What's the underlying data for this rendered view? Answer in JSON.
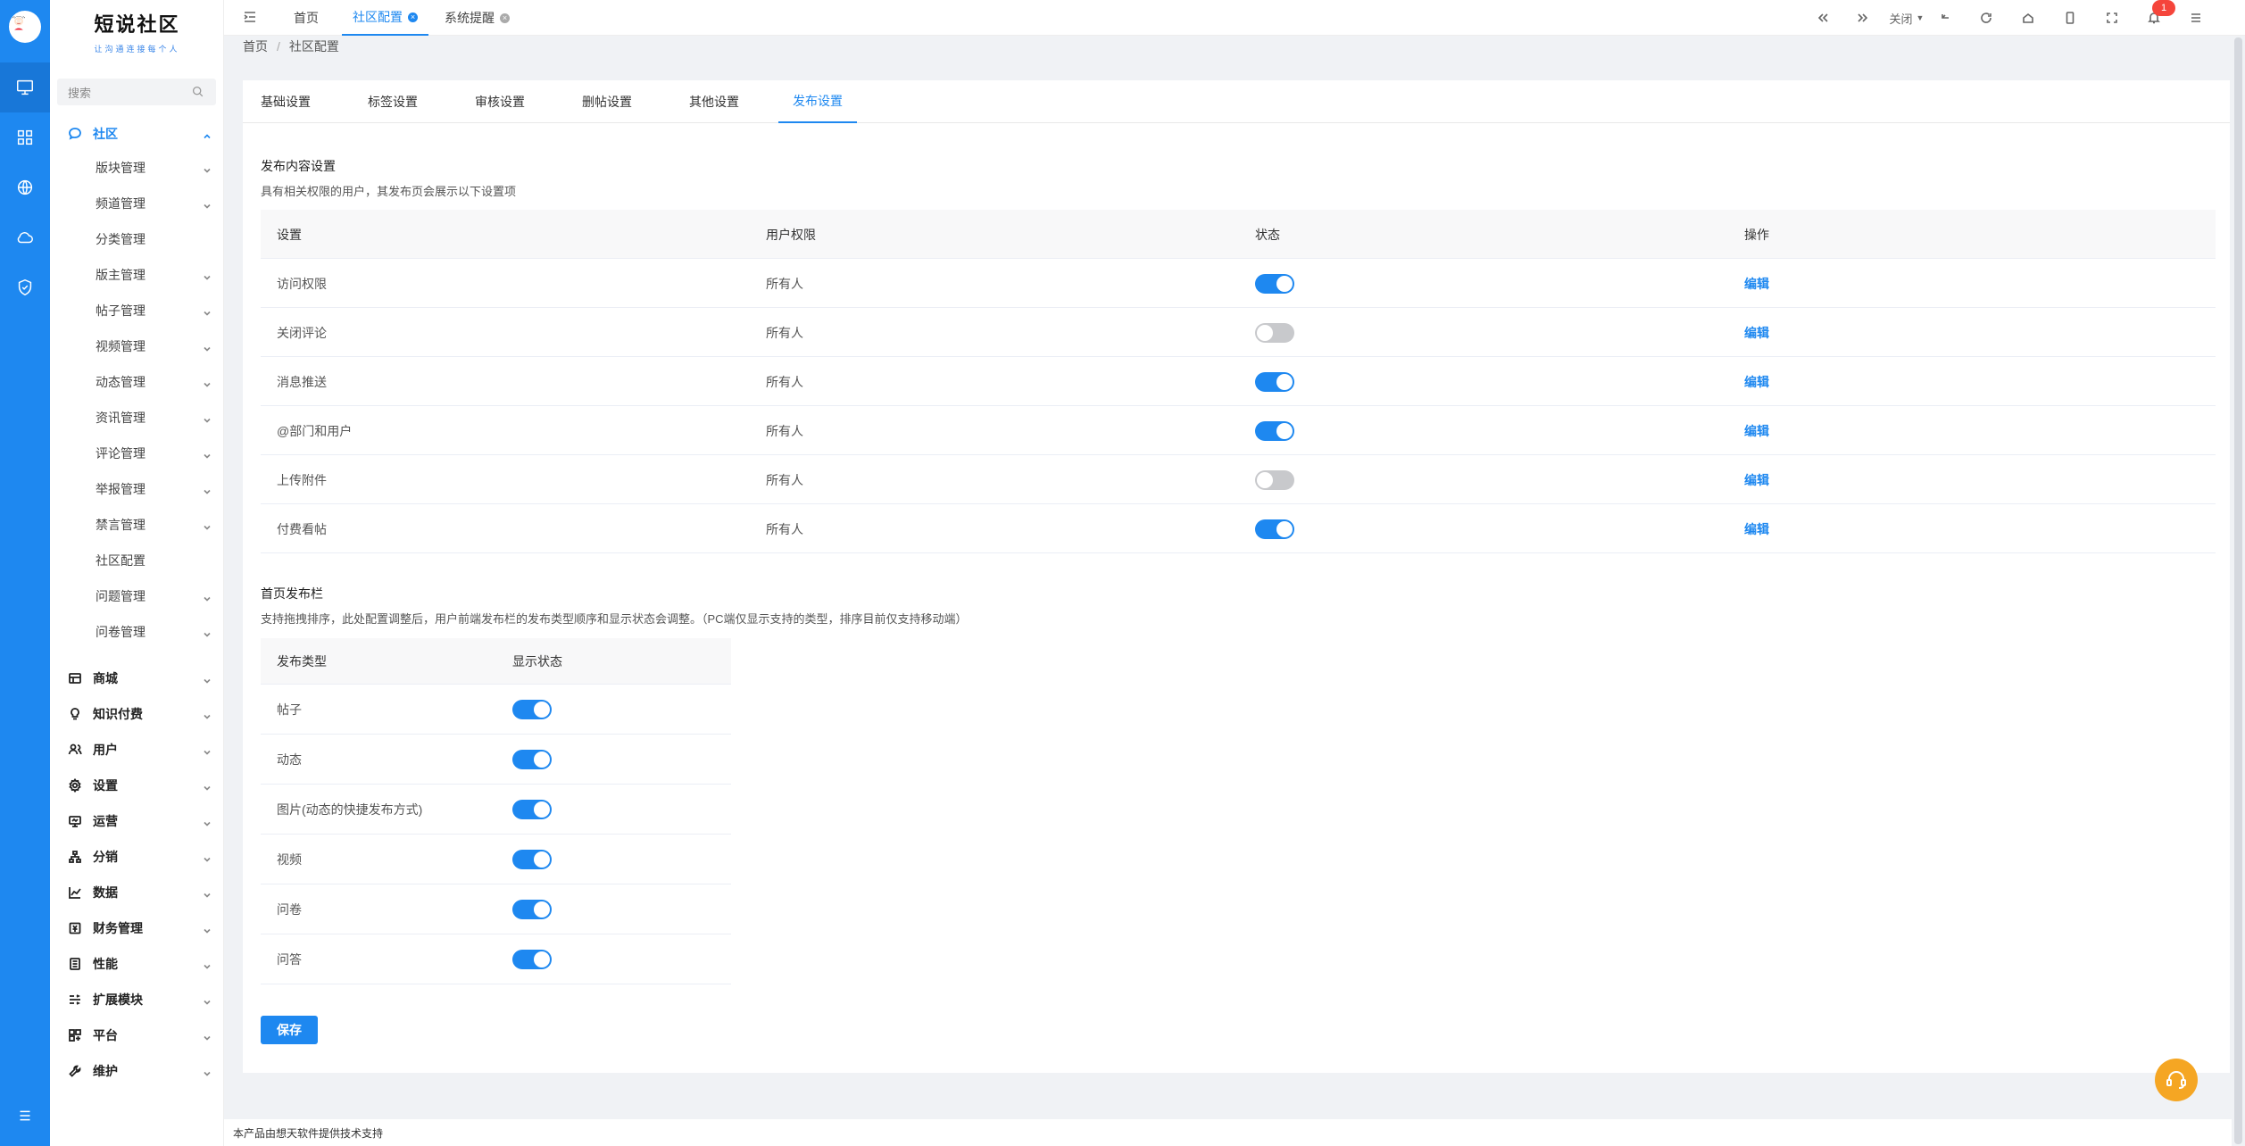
{
  "brand": {
    "name": "短说社区",
    "tagline": "让沟通连接每个人"
  },
  "rail": {
    "icons": [
      "monitor-icon",
      "grid-icon",
      "globe-icon",
      "cloud-icon",
      "shield-check-icon",
      "menu-icon"
    ]
  },
  "sidebar": {
    "search_placeholder": "搜索",
    "open_group": {
      "label": "社区",
      "icon": "chat-icon"
    },
    "sub_items": [
      {
        "label": "版块管理",
        "has_children": true
      },
      {
        "label": "频道管理",
        "has_children": true
      },
      {
        "label": "分类管理",
        "has_children": false
      },
      {
        "label": "版主管理",
        "has_children": true
      },
      {
        "label": "帖子管理",
        "has_children": true
      },
      {
        "label": "视频管理",
        "has_children": true
      },
      {
        "label": "动态管理",
        "has_children": true
      },
      {
        "label": "资讯管理",
        "has_children": true
      },
      {
        "label": "评论管理",
        "has_children": true
      },
      {
        "label": "举报管理",
        "has_children": true
      },
      {
        "label": "禁言管理",
        "has_children": true
      },
      {
        "label": "社区配置",
        "has_children": false
      },
      {
        "label": "问题管理",
        "has_children": true
      },
      {
        "label": "问卷管理",
        "has_children": true
      }
    ],
    "groups": [
      {
        "label": "商城",
        "icon": "shop-icon"
      },
      {
        "label": "知识付费",
        "icon": "bulb-icon"
      },
      {
        "label": "用户",
        "icon": "user-icon"
      },
      {
        "label": "设置",
        "icon": "gear-icon"
      },
      {
        "label": "运营",
        "icon": "screen-icon"
      },
      {
        "label": "分销",
        "icon": "network-icon"
      },
      {
        "label": "数据",
        "icon": "chart-icon"
      },
      {
        "label": "财务管理",
        "icon": "finance-icon"
      },
      {
        "label": "性能",
        "icon": "performance-icon"
      },
      {
        "label": "扩展模块",
        "icon": "extension-icon"
      },
      {
        "label": "平台",
        "icon": "platform-icon"
      },
      {
        "label": "维护",
        "icon": "wrench-icon"
      }
    ]
  },
  "topbar": {
    "tabs": [
      {
        "label": "首页",
        "closable": false,
        "active": false
      },
      {
        "label": "社区配置",
        "closable": true,
        "active": true
      },
      {
        "label": "系统提醒",
        "closable": true,
        "active": false
      }
    ],
    "close_dropdown_label": "关闭",
    "notification_count": "1"
  },
  "breadcrumb": {
    "home": "首页",
    "current": "社区配置"
  },
  "settings_tabs": [
    "基础设置",
    "标签设置",
    "审核设置",
    "删帖设置",
    "其他设置",
    "发布设置"
  ],
  "active_settings_tab": "发布设置",
  "publish_content": {
    "title": "发布内容设置",
    "description": "具有相关权限的用户，其发布页会展示以下设置项",
    "columns": [
      "设置",
      "用户权限",
      "状态",
      "操作"
    ],
    "rows": [
      {
        "setting": "访问权限",
        "permission": "所有人",
        "enabled": true,
        "action": "编辑"
      },
      {
        "setting": "关闭评论",
        "permission": "所有人",
        "enabled": false,
        "action": "编辑"
      },
      {
        "setting": "消息推送",
        "permission": "所有人",
        "enabled": true,
        "action": "编辑"
      },
      {
        "setting": "@部门和用户",
        "permission": "所有人",
        "enabled": true,
        "action": "编辑"
      },
      {
        "setting": "上传附件",
        "permission": "所有人",
        "enabled": false,
        "action": "编辑"
      },
      {
        "setting": "付费看帖",
        "permission": "所有人",
        "enabled": true,
        "action": "编辑"
      }
    ]
  },
  "home_publish_bar": {
    "title": "首页发布栏",
    "description": "支持拖拽排序，此处配置调整后，用户前端发布栏的发布类型顺序和显示状态会调整。（PC端仅显示支持的类型，排序目前仅支持移动端）",
    "columns": [
      "发布类型",
      "显示状态"
    ],
    "rows": [
      {
        "type": "帖子",
        "visible": true
      },
      {
        "type": "动态",
        "visible": true
      },
      {
        "type": "图片(动态的快捷发布方式)",
        "visible": true
      },
      {
        "type": "视频",
        "visible": true
      },
      {
        "type": "问卷",
        "visible": true
      },
      {
        "type": "问答",
        "visible": true
      }
    ]
  },
  "save_label": "保存",
  "footer_text": "本产品由想天软件提供技术支持",
  "colors": {
    "primary": "#1e88f0",
    "switch_off": "#c8c9cc",
    "badge": "#f5453b",
    "support": "#f5a623"
  }
}
